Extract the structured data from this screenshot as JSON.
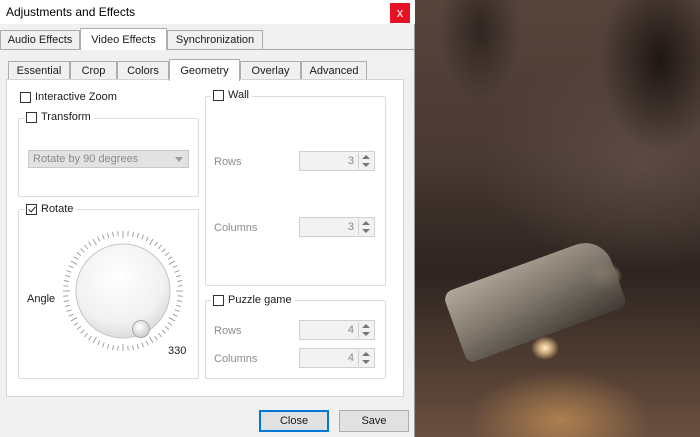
{
  "window": {
    "title": "Adjustments and Effects",
    "close_glyph": "x"
  },
  "main_tabs": [
    {
      "label": "Audio Effects",
      "active": false
    },
    {
      "label": "Video Effects",
      "active": true
    },
    {
      "label": "Synchronization",
      "active": false
    }
  ],
  "sub_tabs": [
    {
      "label": "Essential",
      "active": false
    },
    {
      "label": "Crop",
      "active": false
    },
    {
      "label": "Colors",
      "active": false
    },
    {
      "label": "Geometry",
      "active": true
    },
    {
      "label": "Overlay",
      "active": false
    },
    {
      "label": "Advanced",
      "active": false
    }
  ],
  "geometry": {
    "interactive_zoom": {
      "label": "Interactive Zoom",
      "checked": false
    },
    "transform": {
      "label": "Transform",
      "checked": false,
      "selected": "Rotate by 90 degrees"
    },
    "rotate": {
      "label": "Rotate",
      "checked": true,
      "angle_label": "Angle",
      "angle_value": "330"
    },
    "wall": {
      "label": "Wall",
      "checked": false,
      "rows_label": "Rows",
      "rows_value": "3",
      "columns_label": "Columns",
      "columns_value": "3"
    },
    "puzzle": {
      "label": "Puzzle game",
      "checked": false,
      "rows_label": "Rows",
      "rows_value": "4",
      "columns_label": "Columns",
      "columns_value": "4"
    }
  },
  "buttons": {
    "close": "Close",
    "save": "Save"
  },
  "colors": {
    "close_button": "#e81123",
    "focus_border": "#0078d7"
  }
}
